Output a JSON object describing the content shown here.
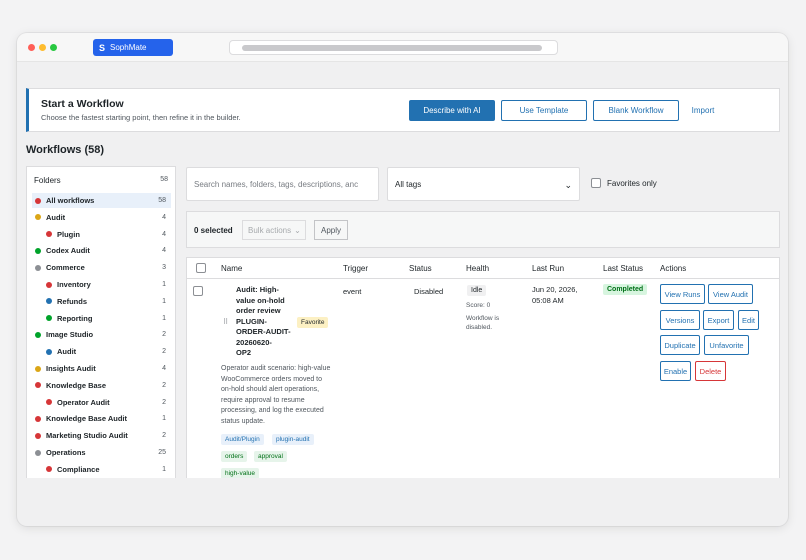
{
  "browser": {
    "tab_logo": "S",
    "tab_label": "SophMate"
  },
  "start": {
    "title": "Start a Workflow",
    "subtitle": "Choose the fastest starting point, then refine it in the builder.",
    "describe_ai": "Describe with AI",
    "use_template": "Use Template",
    "blank_workflow": "Blank Workflow",
    "import": "Import"
  },
  "page_title": "Workflows (58)",
  "folders": {
    "heading": "Folders",
    "total": "58",
    "items": [
      {
        "label": "All workflows",
        "count": "58",
        "color": "#d63638",
        "indent": 0,
        "active": true
      },
      {
        "label": "Audit",
        "count": "4",
        "color": "#dba617",
        "indent": 0
      },
      {
        "label": "Plugin",
        "count": "4",
        "color": "#d63638",
        "indent": 1
      },
      {
        "label": "Codex Audit",
        "count": "4",
        "color": "#00a32a",
        "indent": 0
      },
      {
        "label": "Commerce",
        "count": "3",
        "color": "#8c8f94",
        "indent": 0
      },
      {
        "label": "Inventory",
        "count": "1",
        "color": "#d63638",
        "indent": 1
      },
      {
        "label": "Refunds",
        "count": "1",
        "color": "#2271b1",
        "indent": 1
      },
      {
        "label": "Reporting",
        "count": "1",
        "color": "#00a32a",
        "indent": 1
      },
      {
        "label": "Image Studio",
        "count": "2",
        "color": "#00a32a",
        "indent": 0
      },
      {
        "label": "Audit",
        "count": "2",
        "color": "#2271b1",
        "indent": 1
      },
      {
        "label": "Insights Audit",
        "count": "4",
        "color": "#dba617",
        "indent": 0
      },
      {
        "label": "Knowledge Base",
        "count": "2",
        "color": "#d63638",
        "indent": 0
      },
      {
        "label": "Operator Audit",
        "count": "2",
        "color": "#d63638",
        "indent": 1
      },
      {
        "label": "Knowledge Base Audit",
        "count": "1",
        "color": "#d63638",
        "indent": 0
      },
      {
        "label": "Marketing Studio Audit",
        "count": "2",
        "color": "#d63638",
        "indent": 0
      },
      {
        "label": "Operations",
        "count": "25",
        "color": "#8c8f94",
        "indent": 0
      },
      {
        "label": "Compliance",
        "count": "1",
        "color": "#d63638",
        "indent": 1
      }
    ]
  },
  "filters": {
    "search_placeholder": "Search names, folders, tags, descriptions, anc",
    "tags_value": "All tags",
    "favorites_label": "Favorites only"
  },
  "bulk": {
    "selected": "0 selected",
    "actions": "Bulk actions",
    "apply": "Apply"
  },
  "table": {
    "headers": [
      "Name",
      "Trigger",
      "Status",
      "Health",
      "Last Run",
      "Last Status",
      "Actions"
    ],
    "row": {
      "title_lines": [
        "Audit: High-",
        "value on-hold",
        "order review",
        "PLUGIN-",
        "ORDER-AUDIT-",
        "20260620-",
        "OP2"
      ],
      "favorite": "Favorite",
      "description": "Operator audit scenario: high-value WooCommerce orders moved to on-hold should alert operations, require approval to resume processing, and log the executed status update.",
      "tags": [
        "Audit/Plugin",
        "plugin-audit",
        "orders",
        "approval",
        "high-value"
      ],
      "trigger": "event",
      "status": "Disabled",
      "health_badge": "Idle",
      "health_score": "Score: 0",
      "health_note_1": "Workflow is",
      "health_note_2": "disabled.",
      "last_run_1": "Jun 20, 2026,",
      "last_run_2": "05:08 AM",
      "last_status": "Completed",
      "actions": [
        "View Runs",
        "View Audit",
        "Versions",
        "Export",
        "Edit",
        "Duplicate",
        "Unfavorite",
        "Enable",
        "Delete"
      ]
    }
  }
}
